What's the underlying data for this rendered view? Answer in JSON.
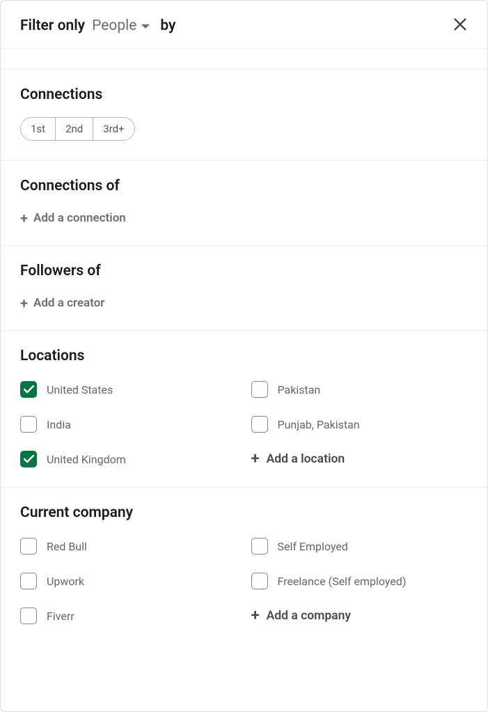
{
  "header": {
    "title": "Filter only",
    "dropdown": "People",
    "by": "by"
  },
  "sections": {
    "connections": {
      "title": "Connections",
      "pills": [
        "1st",
        "2nd",
        "3rd+"
      ]
    },
    "connections_of": {
      "title": "Connections of",
      "add": "Add a connection"
    },
    "followers_of": {
      "title": "Followers of",
      "add": "Add a creator"
    },
    "locations": {
      "title": "Locations",
      "items": [
        {
          "label": "United States",
          "checked": true
        },
        {
          "label": "Pakistan",
          "checked": false
        },
        {
          "label": "India",
          "checked": false
        },
        {
          "label": "Punjab, Pakistan",
          "checked": false
        },
        {
          "label": "United Kingdom",
          "checked": true
        }
      ],
      "add": "Add a location"
    },
    "current_company": {
      "title": "Current company",
      "items": [
        {
          "label": "Red Bull",
          "checked": false
        },
        {
          "label": "Self Employed",
          "checked": false
        },
        {
          "label": "Upwork",
          "checked": false
        },
        {
          "label": "Freelance (Self employed)",
          "checked": false
        },
        {
          "label": "Fiverr",
          "checked": false
        }
      ],
      "add": "Add a company"
    }
  }
}
